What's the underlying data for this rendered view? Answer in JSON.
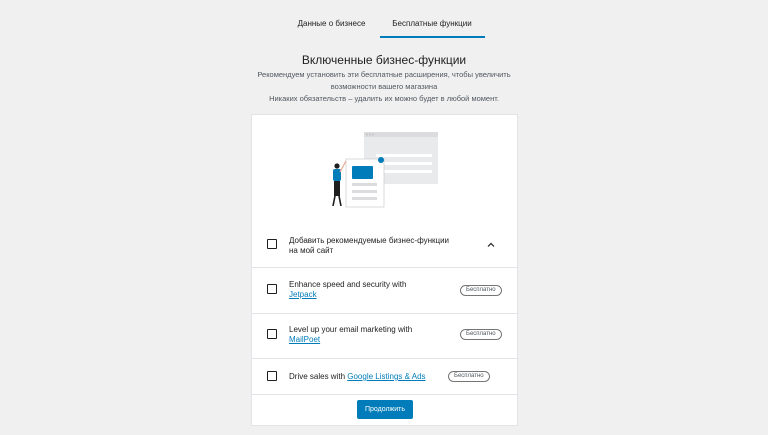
{
  "tabs": [
    {
      "label": "Данные о бизнесе",
      "active": false
    },
    {
      "label": "Бесплатные функции",
      "active": true
    }
  ],
  "main": {
    "title": "Включенные бизнес-функции",
    "subtitle_line1": "Рекомендуем установить эти бесплатные расширения, чтобы увеличить",
    "subtitle_line2": "возможности вашего магазина",
    "subtitle_line3": "Никаких обязательств – удалить их можно будет в любой момент."
  },
  "extensions": {
    "master_label_line1": "Добавить рекомендуемые бизнес-функции",
    "master_label_line2": "на мой сайт",
    "items": [
      {
        "text": "Enhance speed and security with",
        "link": "Jetpack",
        "badge": "Бесплатно"
      },
      {
        "text": "Level up your email marketing with",
        "link": "MailPoet",
        "badge": "Бесплатно"
      },
      {
        "text": "Drive sales with ",
        "link": "Google Listings & Ads",
        "badge": "Бесплатно"
      }
    ]
  },
  "continue_label": "Продолжить",
  "colors": {
    "accent": "#007cba",
    "background": "#f0f0f1"
  },
  "icons": {
    "collapse": "chevron-up-icon"
  }
}
